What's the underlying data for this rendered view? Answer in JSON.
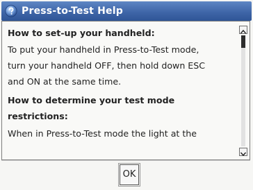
{
  "window": {
    "title": "Press-to-Test Help",
    "title_icon": "help-question-icon"
  },
  "content": {
    "sections": [
      {
        "heading": "How to set-up your handheld:",
        "body_lines": [
          "To put your handheld in Press-to-Test mode,",
          "turn your handheld OFF, then hold down ESC",
          "and ON at the same time."
        ]
      },
      {
        "heading_lines": [
          "How to determine your test mode",
          "restrictions:"
        ],
        "body_lines": [
          "When in Press-to-Test mode the light at the"
        ]
      }
    ]
  },
  "scrollbar": {
    "up_icon": "scroll-up-arrow-icon",
    "down_icon": "scroll-down-arrow-icon",
    "position": 0
  },
  "buttons": {
    "ok_label": "OK"
  },
  "colors": {
    "titlebar": "#3f66a8",
    "title_text": "#ffffff",
    "background": "#f6f6f4"
  }
}
